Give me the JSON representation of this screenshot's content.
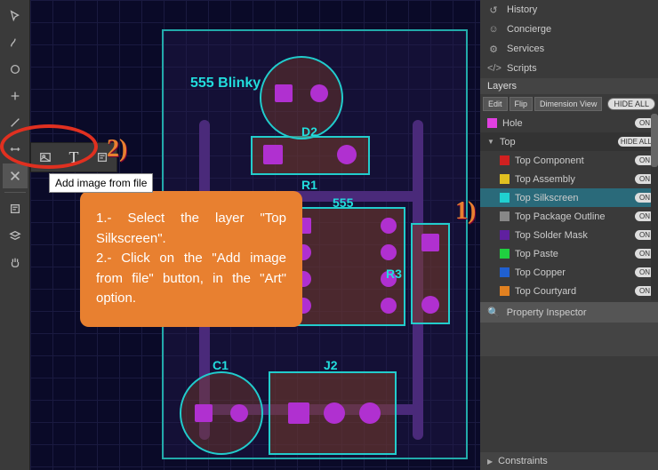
{
  "toolbar_left": {
    "tools": [
      "select",
      "route",
      "circle",
      "add",
      "line",
      "measure",
      "art",
      "text",
      "note",
      "layers",
      "pan"
    ]
  },
  "flyout": {
    "items": [
      "image",
      "text",
      "note"
    ],
    "tooltip": "Add image from file"
  },
  "canvas": {
    "board_title": "555 Blinky",
    "components": {
      "D2": "D2",
      "R1": "R1",
      "ic555": "555",
      "R3": "R3",
      "C1": "C1",
      "J2": "J2"
    }
  },
  "annotations": {
    "num1": "1)",
    "num2": "2)",
    "callout": "1.- Select the layer \"Top Silkscreen\".\n2.- Click on the \"Add image from file\" button, in the \"Art\" option."
  },
  "right_panel": {
    "nav": [
      {
        "icon": "history",
        "label": "History"
      },
      {
        "icon": "concierge",
        "label": "Concierge"
      },
      {
        "icon": "services",
        "label": "Services"
      },
      {
        "icon": "scripts",
        "label": "Scripts"
      }
    ],
    "layers_title": "Layers",
    "buttons": {
      "edit": "Edit",
      "flip": "Flip",
      "dimview": "Dimension View",
      "hideall": "HIDE ALL"
    },
    "hole": {
      "name": "Hole",
      "color": "#e040e0",
      "toggle": "ON"
    },
    "top_group": {
      "name": "Top",
      "toggle": "HIDE ALL"
    },
    "layers": [
      {
        "name": "Top Component",
        "color": "#d02020",
        "toggle": "ON"
      },
      {
        "name": "Top Assembly",
        "color": "#e0c020",
        "toggle": "ON"
      },
      {
        "name": "Top Silkscreen",
        "color": "#20d0d0",
        "toggle": "ON",
        "selected": true
      },
      {
        "name": "Top Package Outline",
        "color": "#888",
        "toggle": "ON"
      },
      {
        "name": "Top Solder Mask",
        "color": "#6020a0",
        "toggle": "ON"
      },
      {
        "name": "Top Paste",
        "color": "#20d040",
        "toggle": "ON"
      },
      {
        "name": "Top Copper",
        "color": "#2060d0",
        "toggle": "ON"
      },
      {
        "name": "Top Courtyard",
        "color": "#e08020",
        "toggle": "ON"
      }
    ],
    "property_inspector": "Property Inspector",
    "constraints": "Constraints"
  }
}
